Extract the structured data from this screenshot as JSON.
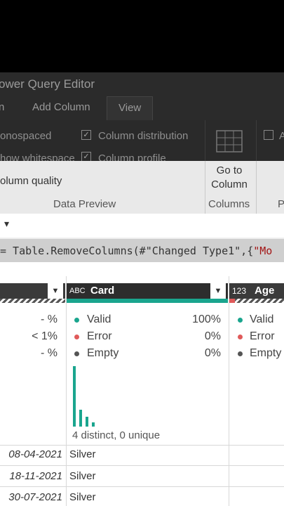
{
  "window": {
    "title": "ower Query Editor"
  },
  "tabs": [
    {
      "label": "n"
    },
    {
      "label": "Add Column"
    },
    {
      "label": "View"
    }
  ],
  "ribbon": {
    "monospaced_label": "onospaced",
    "show_whitespace_label": "how whitespace",
    "column_quality_label": "olumn quality",
    "column_distribution_label": "Column distribution",
    "column_profile_label": "Column profile",
    "column_distribution_checked": true,
    "column_profile_checked": true,
    "goto_label_line1": "Go to",
    "goto_label_line2": "Column",
    "right_check_label": "A",
    "group_data_preview": "Data Preview",
    "group_columns": "Columns",
    "group_partial": "P"
  },
  "query_bar": {
    "dropdown_glyph": "▾"
  },
  "formula": {
    "prefix": "= Table.RemoveColumns(#\"Changed Type1\",{",
    "string_part": "\"Mo"
  },
  "columns": [
    {
      "label": ""
    },
    {
      "type_icon": "ABC",
      "label": "Card"
    },
    {
      "type_icon": "123",
      "label": "Age"
    }
  ],
  "quality": {
    "col0": {
      "valid": "- %",
      "error": "< 1%",
      "empty": "- %"
    },
    "col1": {
      "valid_label": "Valid",
      "valid_pct": "100%",
      "error_label": "Error",
      "error_pct": "0%",
      "empty_label": "Empty",
      "empty_pct": "0%"
    },
    "col2": {
      "valid_label": "Valid",
      "error_label": "Error",
      "empty_label": "Empty"
    }
  },
  "distribution": {
    "summary": "4 distinct, 0 unique",
    "bars": [
      88,
      25,
      14,
      6
    ]
  },
  "rows": [
    {
      "date": "08-04-2021",
      "card": "Silver"
    },
    {
      "date": "18-11-2021",
      "card": "Silver"
    },
    {
      "date": "30-07-2021",
      "card": "Silver"
    }
  ],
  "colors": {
    "valid": "#1aa58e",
    "error": "#e05a5a",
    "empty": "#555555"
  }
}
